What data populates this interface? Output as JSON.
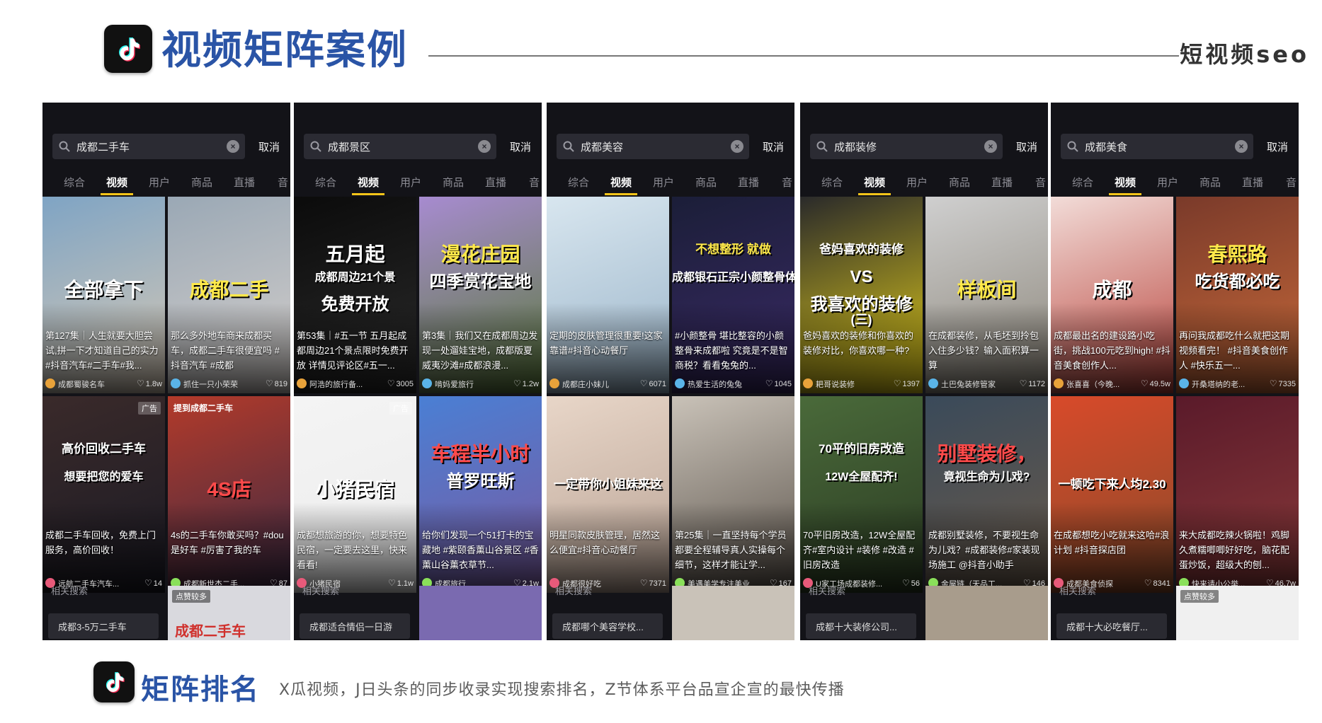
{
  "header": {
    "title": "视频矩阵案例",
    "brand": "短视频seo"
  },
  "tab_labels": [
    "综合",
    "视频",
    "用户",
    "商品",
    "直播",
    "音"
  ],
  "cancel_label": "取消",
  "related_label": "相关搜索",
  "panels": [
    {
      "query": "成都二手车",
      "cards": [
        {
          "overlay": "全部拿下",
          "caption": "第127集｜人生就要大胆尝试,拼一下才知道自己的实力#抖音汽车#二手车#我...",
          "author": "成都蜀骏名车",
          "likes": "1.8w"
        },
        {
          "overlay": "成都二手",
          "caption": "那么多外地车商来成都买车，成都二手车很便宜吗 #抖音汽车 #成都",
          "author": "抓住一只小荣荣",
          "likes": "819"
        },
        {
          "overlay": "高价回收二手车",
          "overlay2": "想要把您的爱车",
          "badge": "广告",
          "caption": "成都二手车回收，免费上门服务，高价回收！",
          "author": "远航二手车汽车...",
          "likes": "14"
        },
        {
          "overlay": "4S店",
          "overlay_top": "提到成都二手车",
          "caption": "4s的二手车你敢买吗？#dou是好车 #厉害了我的车",
          "author": "成都新世杰二手...",
          "likes": "87"
        }
      ],
      "related": "成都3-5万二手车",
      "bottom_badge": "点赞较多",
      "bottom_text": "成都二手车"
    },
    {
      "query": "成都景区",
      "cards": [
        {
          "overlay": "五月起",
          "overlay2": "成都周边21个景",
          "overlay3": "免费开放",
          "caption": "第53集｜#五一节 五月起成都周边21个景点限时免费开放 详情见评论区#五一...",
          "author": "阿浩的旅行备...",
          "likes": "3005"
        },
        {
          "overlay": "漫花庄园",
          "overlay2": "四季赏花宝地",
          "caption": "第3集｜我们又在成都周边发现一处遛娃宝地，成都版夏威夷沙滩#成都浪漫...",
          "author": "啃妈爱旅行",
          "likes": "1.2w"
        },
        {
          "overlay": "小猪民宿",
          "badge": "广告",
          "caption": "成都想旅游的你，想要特色民宿，一定要去这里，快来看看!",
          "author": "小猪民宿",
          "likes": "1.1w"
        },
        {
          "overlay": "车程半小时",
          "overlay2": "普罗旺斯",
          "caption": "给你们发现一个51打卡的宝藏地 #紫颐香薰山谷景区 #香薰山谷薰衣草节...",
          "author": "成都旅行",
          "likes": "2.1w"
        }
      ],
      "related": "成都适合情侣一日游"
    },
    {
      "query": "成都美容",
      "cards": [
        {
          "overlay": "",
          "caption": "定期的皮肤管理很重要!这家靠谱#抖音心动餐厅",
          "author": "成都庄小妹儿",
          "likes": "6071"
        },
        {
          "overlay": "不想整形 就做",
          "overlay2": "成都银石正宗小颜整骨体验",
          "caption": "#小颜整骨 堪比整容的小颜整骨来成都啦 究竟是不是智商税？看看兔兔的...",
          "author": "热爱生活的兔兔",
          "likes": "1045"
        },
        {
          "overlay": "一定带你小姐妹来这",
          "caption": "明星同款皮肤管理，居然这么便宜#抖音心动餐厅",
          "author": "成都很好吃",
          "likes": "7371"
        },
        {
          "overlay": "",
          "caption": "第25集｜一直坚持每个学员都要全程辅导真人实操每个细节，这样才能让学...",
          "author": "美遇美学专注美业",
          "likes": "167"
        }
      ],
      "related": "成都哪个美容学校..."
    },
    {
      "query": "成都装修",
      "cards": [
        {
          "overlay": "爸妈喜欢的装修",
          "overlay2": "VS",
          "overlay3": "我喜欢的装修",
          "overlay4": "(三)",
          "caption": "爸妈喜欢的装修和你喜欢的装修对比，你喜欢哪一种?",
          "author": "耙哥说装修",
          "likes": "1397"
        },
        {
          "overlay": "样板间",
          "caption": "在成都装修，从毛坯到拎包入住多少钱？输入面积算一算",
          "author": "土巴兔装修管家",
          "likes": "1172"
        },
        {
          "overlay": "70平的旧房改造",
          "overlay2": "12W全屋配齐!",
          "caption": "70平旧房改造，12W全屋配齐#室内设计 #装修 #改造 #旧房改造",
          "author": "U家工场成都装修...",
          "likes": "56"
        },
        {
          "overlay": "别墅装修，",
          "overlay2": "竟视生命为儿戏?",
          "caption": "成都别墅装修，不要视生命为儿戏？#成都装修#家装现场施工 @抖音小助手",
          "author": "金屋链（天品工...",
          "likes": "146"
        }
      ],
      "related": "成都十大装修公司..."
    },
    {
      "query": "成都美食",
      "cards": [
        {
          "overlay": "成都",
          "caption": "成都最出名的建设路小吃街，挑战100元吃到high! #抖音美食创作人...",
          "author": "张喜喜（今晚...",
          "likes": "49.5w"
        },
        {
          "overlay": "春熙路",
          "overlay2": "吃货都必吃",
          "caption": "再问我成都吃什么就把这期视频看完！ #抖音美食创作人 #快乐五一...",
          "author": "开桑塔纳的老...",
          "likes": "7335"
        },
        {
          "overlay": "一顿吃下来人均2.30",
          "caption": "在成都想吃小吃就来这哈#浪计划 #抖音探店团",
          "author": "成都美食侦探",
          "likes": "8341"
        },
        {
          "overlay": "",
          "caption": "来大成都吃辣火锅啦！鸡脚久煮糯唧唧好好吃，脑花配蛋炒饭，超级大的刨...",
          "author": "快来请小公举...",
          "likes": "46.7w"
        }
      ],
      "related": "成都十大必吃餐厅...",
      "bottom_badge": "点赞较多"
    }
  ],
  "footer": {
    "title": "矩阵排名",
    "description": "X瓜视频，J日头条的同步收录实现搜索排名，Z节体系平台品宣企宣的最快传播"
  },
  "colors": {
    "title_blue": "#2a54a6",
    "tab_underline": "#f6c519",
    "panel_bg": "#131318"
  },
  "icons": [
    "tiktok-logo-icon",
    "search-icon",
    "clear-icon",
    "heart-icon",
    "layers-icon"
  ]
}
